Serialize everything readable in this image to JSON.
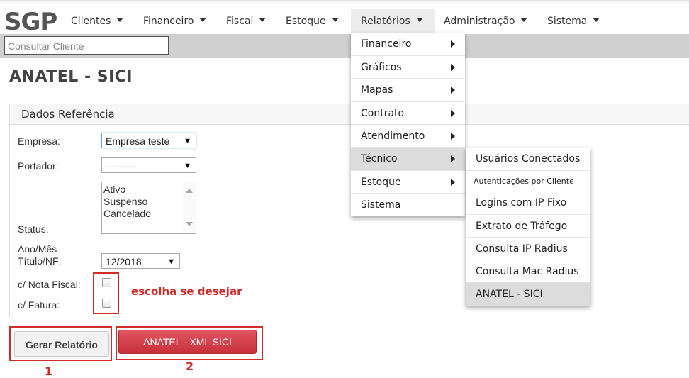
{
  "app": {
    "logo_text": "SGP"
  },
  "nav": {
    "items": [
      {
        "label": "Clientes"
      },
      {
        "label": "Financeiro"
      },
      {
        "label": "Fiscal"
      },
      {
        "label": "Estoque"
      },
      {
        "label": "Relatórios"
      },
      {
        "label": "Administração"
      },
      {
        "label": "Sistema"
      }
    ]
  },
  "search": {
    "placeholder": "Consultar Cliente"
  },
  "page": {
    "title": "ANATEL - SICI"
  },
  "panel": {
    "title": "Dados Referência"
  },
  "form": {
    "empresa_label": "Empresa:",
    "empresa_value": "Empresa teste",
    "portador_label": "Portador:",
    "portador_value": "---------",
    "status_label": "Status:",
    "status_options": [
      "Ativo",
      "Suspenso",
      "Cancelado"
    ],
    "anomes_label_1": "Ano/Mês",
    "anomes_label_2": "Título/NF:",
    "anomes_value": "12/2018",
    "nota_fiscal_label": "c/ Nota Fiscal:",
    "fatura_label": "c/ Fatura:",
    "hint": "escolha se desejar"
  },
  "buttons": {
    "gerar": "Gerar Relatório",
    "xml": "ANATEL - XML SICI",
    "num1": "1",
    "num2": "2"
  },
  "relatorios_menu": {
    "items": [
      {
        "label": "Financeiro"
      },
      {
        "label": "Gráficos"
      },
      {
        "label": "Mapas"
      },
      {
        "label": "Contrato"
      },
      {
        "label": "Atendimento"
      },
      {
        "label": "Técnico"
      },
      {
        "label": "Estoque"
      },
      {
        "label": "Sistema"
      }
    ]
  },
  "tecnico_menu": {
    "items": [
      {
        "label": "Usuários Conectados"
      },
      {
        "label": "Autenticações por Cliente"
      },
      {
        "label": "Logins com IP Fixo"
      },
      {
        "label": "Extrato de Tráfego"
      },
      {
        "label": "Consulta IP Radius"
      },
      {
        "label": "Consulta Mac Radius"
      },
      {
        "label": "ANATEL - SICI"
      }
    ]
  },
  "colors": {
    "accent_red": "#d32a2a",
    "button_red": "#c8303b",
    "gray_bar": "#d0d0d0"
  }
}
